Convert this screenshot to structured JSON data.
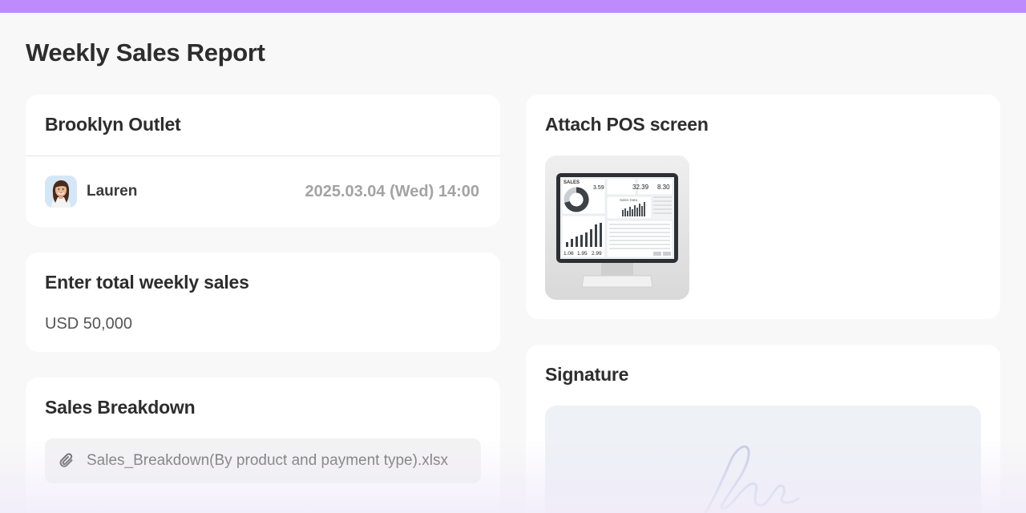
{
  "page": {
    "title": "Weekly Sales Report"
  },
  "colors": {
    "accent_bar": "#bd8bfb",
    "background": "#f8f8f8",
    "card": "#ffffff"
  },
  "outlet": {
    "name": "Brooklyn Outlet",
    "user": {
      "name": "Lauren",
      "avatar_icon": "avatar-woman"
    },
    "timestamp": "2025.03.04 (Wed) 14:00"
  },
  "sales_total": {
    "title": "Enter total weekly sales",
    "value": "USD 50,000"
  },
  "breakdown": {
    "title": "Sales Breakdown",
    "attachment_icon": "paperclip-icon",
    "file_name": "Sales_Breakdown(By product and payment type).xlsx"
  },
  "attach": {
    "title": "Attach POS screen",
    "thumbnail": {
      "screen_title": "SALES",
      "readouts": [
        "3.59",
        "32.39",
        "8.30"
      ],
      "footer_values": [
        "1.06",
        "1.95",
        "2.99"
      ],
      "chart_caption": "Sales Data"
    }
  },
  "signature": {
    "title": "Signature"
  }
}
